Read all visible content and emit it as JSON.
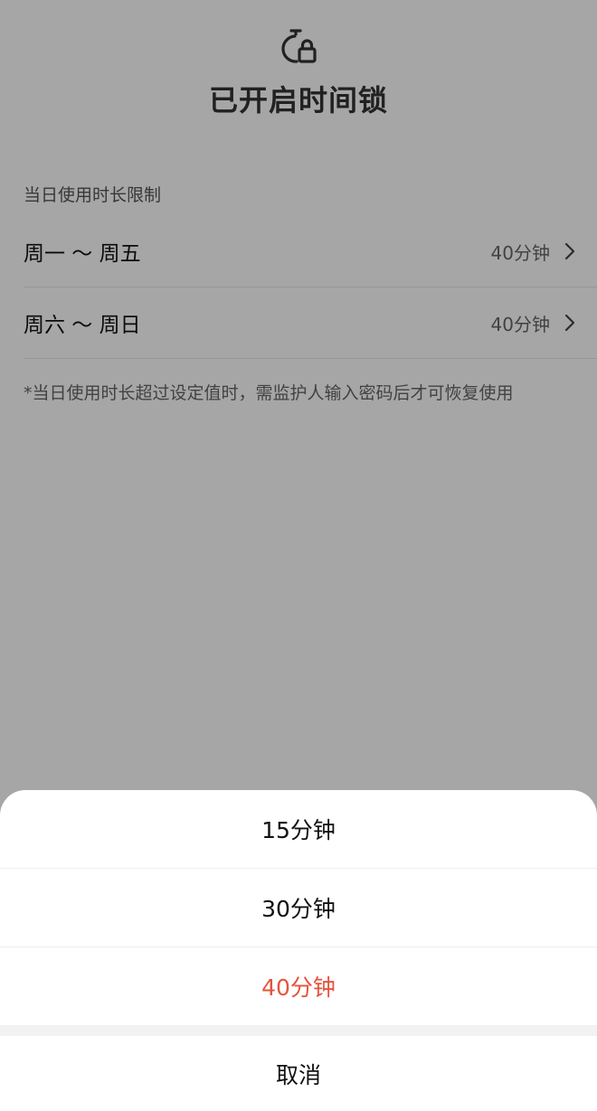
{
  "header": {
    "title": "已开启时间锁",
    "icon": "timer-lock-icon"
  },
  "section": {
    "header": "当日使用时长限制"
  },
  "rows": [
    {
      "label": "周一 ～ 周五",
      "value": "40分钟"
    },
    {
      "label": "周六 ～ 周日",
      "value": "40分钟"
    }
  ],
  "footnote": "*当日使用时长超过设定值时，需监护人输入密码后才可恢复使用",
  "sheet": {
    "options": [
      {
        "label": "15分钟",
        "selected": false
      },
      {
        "label": "30分钟",
        "selected": false
      },
      {
        "label": "40分钟",
        "selected": true
      }
    ],
    "cancel": "取消"
  },
  "colors": {
    "selected": "#e5533d",
    "text": "#111111",
    "secondary": "#666666",
    "overlay": "rgba(0,0,0,0.35)"
  }
}
